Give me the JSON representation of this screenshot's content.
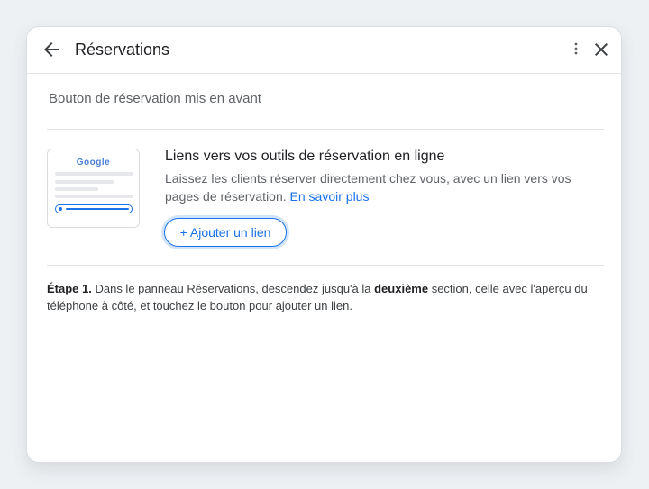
{
  "header": {
    "title": "Réservations",
    "back_icon": "arrow-left-icon",
    "more_icon": "more-vertical-icon",
    "close_icon": "close-icon"
  },
  "section": {
    "title": "Bouton de réservation mis en avant"
  },
  "preview": {
    "brand": "Google"
  },
  "feature": {
    "title": "Liens vers vos outils de réservation en ligne",
    "description": "Laissez les clients réserver directement chez vous, avec un lien vers vos pages de réservation.",
    "learn_more": "En savoir plus",
    "add_link_button": "+ Ajouter un lien"
  },
  "instruction": {
    "step_label": "Étape 1.",
    "text_before": " Dans le panneau Réservations, descendez jusqu'à la ",
    "emphasis": "deuxième",
    "text_after": " section, celle avec l'aperçu du téléphone à côté, et touchez le bouton pour ajouter un lien."
  },
  "colors": {
    "accent": "#1a73e8",
    "text_primary": "#202124",
    "text_secondary": "#5f6368"
  }
}
